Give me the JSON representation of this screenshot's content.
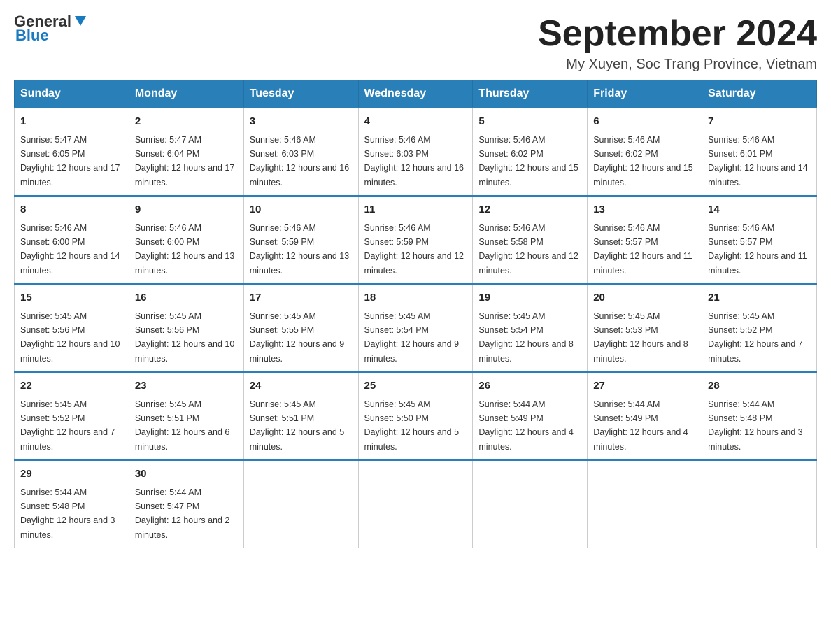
{
  "header": {
    "logo_general": "General",
    "logo_blue": "Blue",
    "month_title": "September 2024",
    "location": "My Xuyen, Soc Trang Province, Vietnam"
  },
  "calendar": {
    "headers": [
      "Sunday",
      "Monday",
      "Tuesday",
      "Wednesday",
      "Thursday",
      "Friday",
      "Saturday"
    ],
    "weeks": [
      [
        {
          "day": "1",
          "sunrise": "5:47 AM",
          "sunset": "6:05 PM",
          "daylight": "12 hours and 17 minutes."
        },
        {
          "day": "2",
          "sunrise": "5:47 AM",
          "sunset": "6:04 PM",
          "daylight": "12 hours and 17 minutes."
        },
        {
          "day": "3",
          "sunrise": "5:46 AM",
          "sunset": "6:03 PM",
          "daylight": "12 hours and 16 minutes."
        },
        {
          "day": "4",
          "sunrise": "5:46 AM",
          "sunset": "6:03 PM",
          "daylight": "12 hours and 16 minutes."
        },
        {
          "day": "5",
          "sunrise": "5:46 AM",
          "sunset": "6:02 PM",
          "daylight": "12 hours and 15 minutes."
        },
        {
          "day": "6",
          "sunrise": "5:46 AM",
          "sunset": "6:02 PM",
          "daylight": "12 hours and 15 minutes."
        },
        {
          "day": "7",
          "sunrise": "5:46 AM",
          "sunset": "6:01 PM",
          "daylight": "12 hours and 14 minutes."
        }
      ],
      [
        {
          "day": "8",
          "sunrise": "5:46 AM",
          "sunset": "6:00 PM",
          "daylight": "12 hours and 14 minutes."
        },
        {
          "day": "9",
          "sunrise": "5:46 AM",
          "sunset": "6:00 PM",
          "daylight": "12 hours and 13 minutes."
        },
        {
          "day": "10",
          "sunrise": "5:46 AM",
          "sunset": "5:59 PM",
          "daylight": "12 hours and 13 minutes."
        },
        {
          "day": "11",
          "sunrise": "5:46 AM",
          "sunset": "5:59 PM",
          "daylight": "12 hours and 12 minutes."
        },
        {
          "day": "12",
          "sunrise": "5:46 AM",
          "sunset": "5:58 PM",
          "daylight": "12 hours and 12 minutes."
        },
        {
          "day": "13",
          "sunrise": "5:46 AM",
          "sunset": "5:57 PM",
          "daylight": "12 hours and 11 minutes."
        },
        {
          "day": "14",
          "sunrise": "5:46 AM",
          "sunset": "5:57 PM",
          "daylight": "12 hours and 11 minutes."
        }
      ],
      [
        {
          "day": "15",
          "sunrise": "5:45 AM",
          "sunset": "5:56 PM",
          "daylight": "12 hours and 10 minutes."
        },
        {
          "day": "16",
          "sunrise": "5:45 AM",
          "sunset": "5:56 PM",
          "daylight": "12 hours and 10 minutes."
        },
        {
          "day": "17",
          "sunrise": "5:45 AM",
          "sunset": "5:55 PM",
          "daylight": "12 hours and 9 minutes."
        },
        {
          "day": "18",
          "sunrise": "5:45 AM",
          "sunset": "5:54 PM",
          "daylight": "12 hours and 9 minutes."
        },
        {
          "day": "19",
          "sunrise": "5:45 AM",
          "sunset": "5:54 PM",
          "daylight": "12 hours and 8 minutes."
        },
        {
          "day": "20",
          "sunrise": "5:45 AM",
          "sunset": "5:53 PM",
          "daylight": "12 hours and 8 minutes."
        },
        {
          "day": "21",
          "sunrise": "5:45 AM",
          "sunset": "5:52 PM",
          "daylight": "12 hours and 7 minutes."
        }
      ],
      [
        {
          "day": "22",
          "sunrise": "5:45 AM",
          "sunset": "5:52 PM",
          "daylight": "12 hours and 7 minutes."
        },
        {
          "day": "23",
          "sunrise": "5:45 AM",
          "sunset": "5:51 PM",
          "daylight": "12 hours and 6 minutes."
        },
        {
          "day": "24",
          "sunrise": "5:45 AM",
          "sunset": "5:51 PM",
          "daylight": "12 hours and 5 minutes."
        },
        {
          "day": "25",
          "sunrise": "5:45 AM",
          "sunset": "5:50 PM",
          "daylight": "12 hours and 5 minutes."
        },
        {
          "day": "26",
          "sunrise": "5:44 AM",
          "sunset": "5:49 PM",
          "daylight": "12 hours and 4 minutes."
        },
        {
          "day": "27",
          "sunrise": "5:44 AM",
          "sunset": "5:49 PM",
          "daylight": "12 hours and 4 minutes."
        },
        {
          "day": "28",
          "sunrise": "5:44 AM",
          "sunset": "5:48 PM",
          "daylight": "12 hours and 3 minutes."
        }
      ],
      [
        {
          "day": "29",
          "sunrise": "5:44 AM",
          "sunset": "5:48 PM",
          "daylight": "12 hours and 3 minutes."
        },
        {
          "day": "30",
          "sunrise": "5:44 AM",
          "sunset": "5:47 PM",
          "daylight": "12 hours and 2 minutes."
        },
        null,
        null,
        null,
        null,
        null
      ]
    ]
  }
}
